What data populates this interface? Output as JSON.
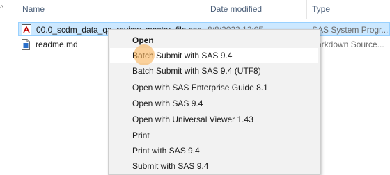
{
  "header": {
    "name": "Name",
    "date_modified": "Date modified",
    "type": "Type"
  },
  "files": [
    {
      "name": "00.0_scdm_data_qa_review_master_file.sas",
      "date": "8/8/2022 12:05",
      "type": "SAS System Progr...",
      "icon": "sas-file-icon",
      "selected": true
    },
    {
      "name": "readme.md",
      "date": "",
      "type": "arkdown Source...",
      "icon": "document-icon",
      "selected": false
    }
  ],
  "context_menu": {
    "items": [
      {
        "label": "Open",
        "bold": true
      },
      {
        "label": "Batch Submit with SAS 9.4",
        "highlighted": true
      },
      {
        "label": "Batch Submit with SAS 9.4 (UTF8)"
      },
      {
        "label": "Open with SAS Enterprise Guide 8.1"
      },
      {
        "label": "Open with SAS 9.4"
      },
      {
        "label": "Open with Universal Viewer 1.43"
      },
      {
        "label": "Print"
      },
      {
        "label": "Print with SAS 9.4"
      },
      {
        "label": "Submit with SAS 9.4"
      }
    ]
  },
  "colors": {
    "selection": "#cce8ff",
    "selection_border": "#99d1ff",
    "menu_background": "#f2f2f2",
    "click_indicator": "#f8ac48"
  }
}
